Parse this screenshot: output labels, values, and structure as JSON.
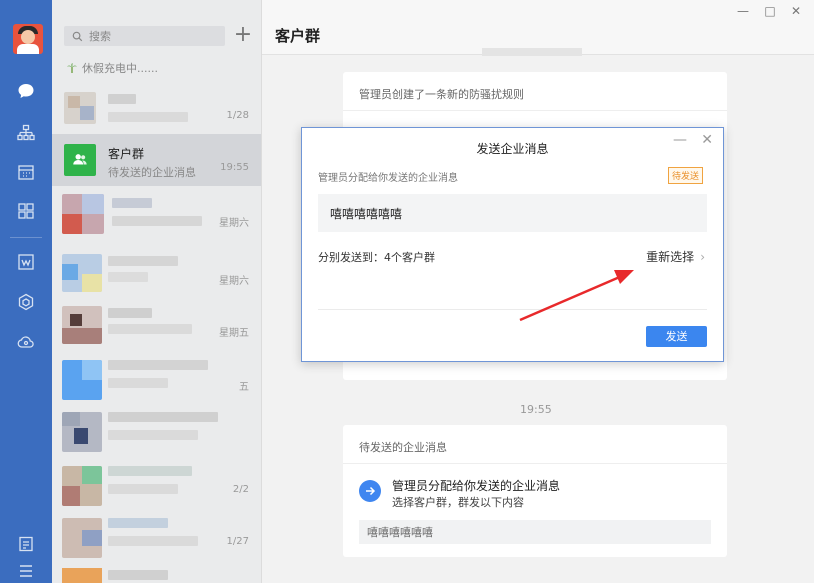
{
  "sidebar": {
    "search_placeholder": "搜索",
    "status_text": "休假充电中......",
    "conversations": [
      {
        "name": "",
        "preview": "",
        "time": "1/28"
      },
      {
        "name": "客户群",
        "preview": "待发送的企业消息",
        "time": "19:55"
      },
      {
        "name": "",
        "preview": "",
        "time": "星期六"
      },
      {
        "name": "",
        "preview": "",
        "time": "星期六"
      },
      {
        "name": "",
        "preview": "",
        "time": "星期五"
      },
      {
        "name": "",
        "preview": "",
        "time": "五"
      },
      {
        "name": "",
        "preview": "",
        "time": ""
      },
      {
        "name": "",
        "preview": "",
        "time": "2/2"
      },
      {
        "name": "",
        "preview": "",
        "time": "1/27"
      }
    ]
  },
  "chat": {
    "title": "客户群",
    "top_card_caption": "管理员创建了一条新的防骚扰规则",
    "timestamp": "19:55",
    "bottom_card": {
      "caption": "待发送的企业消息",
      "line1": "管理员分配给你发送的企业消息",
      "line2": "选择客户群，群发以下内容",
      "content": "嘻嘻嘻嘻嘻嘻"
    }
  },
  "window_controls": {
    "minimize": "—",
    "maximize": "□",
    "close": "✕"
  },
  "dialog": {
    "title": "发送企业消息",
    "subtitle": "管理员分配给你发送的企业消息",
    "badge": "待发送",
    "message": "嘻嘻嘻嘻嘻嘻",
    "send_to": "分别发送到：4个客户群",
    "reselect": "重新选择",
    "send_button": "发送",
    "minimize": "—",
    "close": "✕"
  },
  "colors": {
    "rail": "#3b6dbf",
    "accent": "#3b86ef",
    "arrow": "#e8292b",
    "badge": "#e9902b",
    "group_avatar": "#2fb34a"
  }
}
